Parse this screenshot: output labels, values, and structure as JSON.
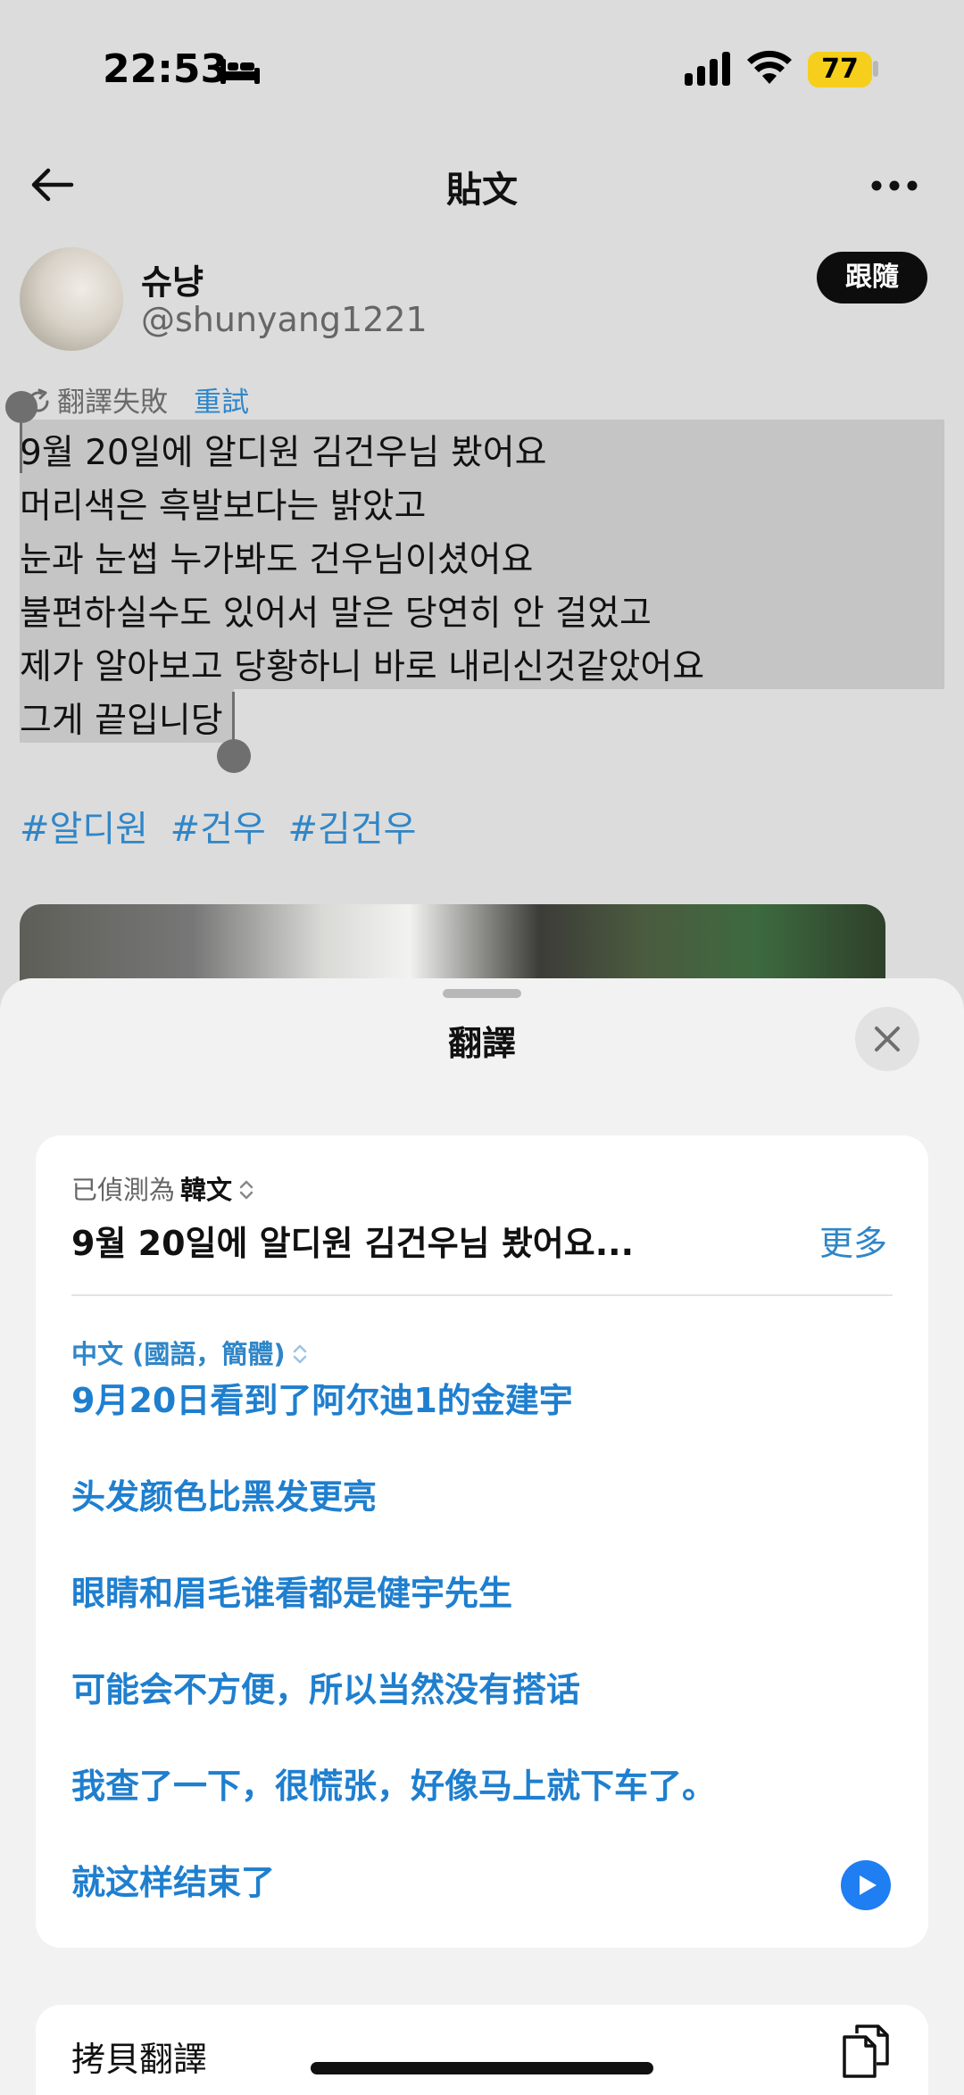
{
  "status_bar": {
    "time": "22:53",
    "battery": "77",
    "icons": [
      "bed-icon",
      "signal-icon",
      "wifi-icon",
      "battery-icon"
    ],
    "battery_color": "#f5cf1c"
  },
  "nav": {
    "title": "貼文",
    "back_icon": "back-arrow-icon",
    "more_icon": "more-icon"
  },
  "author": {
    "display_name": "슈냥",
    "handle": "@shunyang1221",
    "follow_label": "跟隨"
  },
  "translation_status": {
    "text": "翻譯失敗",
    "retry_label": "重試"
  },
  "post": {
    "lines": [
      "9월 20일에 알디원 김건우님 봤어요",
      "머리색은 흑발보다는 밝았고",
      "눈과 눈썹 누가봐도 건우님이셨어요",
      "불편하실수도 있어서 말은 당연히 안 걸었고",
      "제가 알아보고 당황하니 바로 내리신것같았어요",
      "그게 끝입니당"
    ],
    "hashtags": [
      "#알디원",
      "#건우",
      "#김건우"
    ]
  },
  "translate_sheet": {
    "title": "翻譯",
    "detected_prefix": "已偵測為",
    "detected_language": "韓文",
    "source_preview": "9월 20일에 알디원 김건우님 봤어요...",
    "more_label": "更多",
    "target_language": "中文 (國語，簡體)",
    "result_lines": [
      "9月20日看到了阿尔迪1的金建宇",
      "头发颜色比黑发更亮",
      "眼睛和眉毛谁看都是健宇先生",
      "可能会不方便，所以当然没有搭话",
      "我查了一下，很慌张，好像马上就下车了。",
      "就这样结束了"
    ],
    "copy_label": "拷貝翻譯",
    "accent_color": "#2f86c8",
    "play_color": "#1e7ef2"
  }
}
